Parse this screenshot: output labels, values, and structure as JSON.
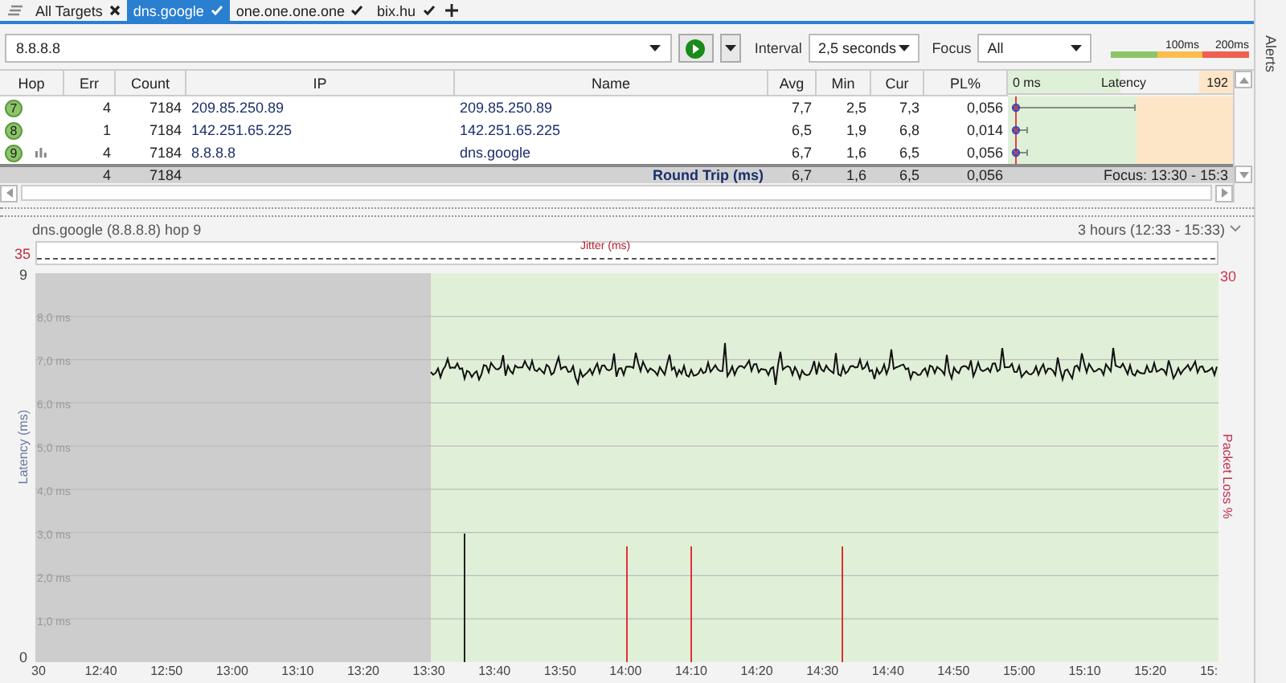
{
  "tabs": [
    {
      "label": "All Targets",
      "kind": "overview",
      "selected": false
    },
    {
      "label": "dns.google",
      "kind": "target",
      "selected": true
    },
    {
      "label": "one.one.one.one",
      "kind": "target",
      "selected": false
    },
    {
      "label": "bix.hu",
      "kind": "target",
      "selected": false
    }
  ],
  "target": {
    "value": "8.8.8.8"
  },
  "interval": {
    "label": "Interval",
    "value": "2,5 seconds"
  },
  "focus": {
    "label": "Focus",
    "value": "All"
  },
  "legend": [
    "100ms",
    "200ms"
  ],
  "alerts": "Alerts",
  "table": {
    "columns": [
      "Hop",
      "Err",
      "Count",
      "IP",
      "Name",
      "Avg",
      "Min",
      "Cur",
      "PL%"
    ],
    "latency_header": {
      "min": "0 ms",
      "title": "Latency",
      "max": "192"
    },
    "rows": [
      {
        "hop": "7",
        "graph_icon": false,
        "err": "4",
        "count": "7184",
        "ip": "209.85.250.89",
        "name": "209.85.250.89",
        "avg": "7,7",
        "min": "2,5",
        "cur": "7,3",
        "pl": "0,056",
        "wide_range": true
      },
      {
        "hop": "8",
        "graph_icon": false,
        "err": "1",
        "count": "7184",
        "ip": "142.251.65.225",
        "name": "142.251.65.225",
        "avg": "6,5",
        "min": "1,9",
        "cur": "6,8",
        "pl": "0,014",
        "wide_range": false
      },
      {
        "hop": "9",
        "graph_icon": true,
        "err": "4",
        "count": "7184",
        "ip": "8.8.8.8",
        "name": "dns.google",
        "avg": "6,7",
        "min": "1,6",
        "cur": "6,5",
        "pl": "0,056",
        "wide_range": false
      }
    ],
    "summary": {
      "err": "4",
      "count": "7184",
      "label": "Round Trip (ms)",
      "avg": "6,7",
      "min": "1,6",
      "cur": "6,5",
      "pl": "0,056",
      "focus": "Focus: 13:30 - 15:3"
    }
  },
  "graph": {
    "title": "dns.google (8.8.8.8) hop 9",
    "range": "3 hours (12:33 - 15:33)",
    "jitter_label": "Jitter (ms)",
    "jitter_max": "35",
    "y_max": "9",
    "y_min": "0",
    "y_labels": [
      "8,0 ms",
      "7,0 ms",
      "6,0 ms",
      "5,0 ms",
      "4,0 ms",
      "3,0 ms",
      "2,0 ms",
      "1,0 ms"
    ],
    "y_title": "Latency (ms)",
    "loss_max": "30",
    "loss_title": "Packet Loss %",
    "x_ticks": [
      "30",
      "12:40",
      "12:50",
      "13:00",
      "13:10",
      "13:20",
      "13:30",
      "13:40",
      "13:50",
      "14:00",
      "14:10",
      "14:20",
      "14:30",
      "14:40",
      "14:50",
      "15:00",
      "15:10",
      "15:20",
      "15:"
    ]
  }
}
